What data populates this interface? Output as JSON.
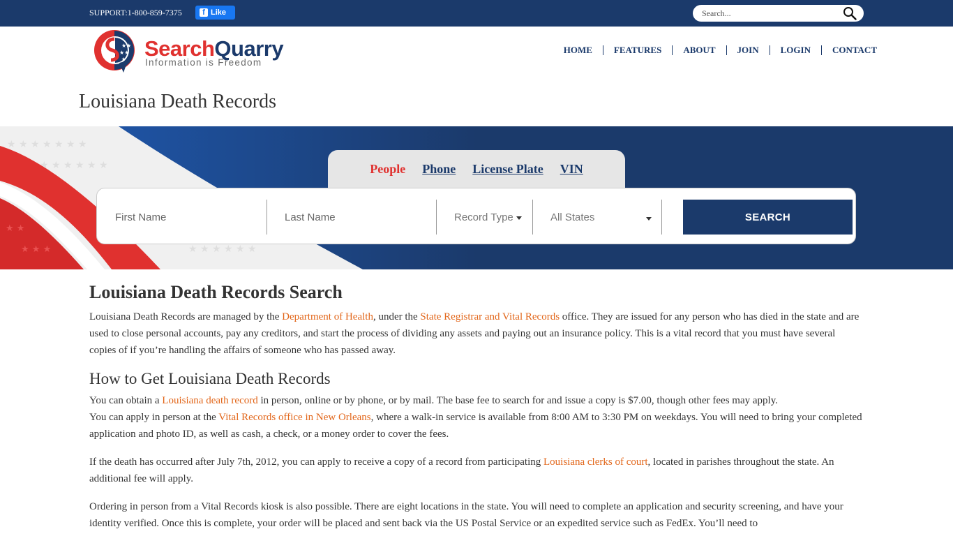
{
  "topbar": {
    "support_text": "SUPPORT:1-800-859-7375",
    "fb_like_label": "Like",
    "search_placeholder": "Search..."
  },
  "header": {
    "logo_name_part1": "Search",
    "logo_name_part2": "Quarry",
    "logo_tagline": "Information is Freedom",
    "nav": [
      "HOME",
      "FEATURES",
      "ABOUT",
      "JOIN",
      "LOGIN",
      "CONTACT"
    ]
  },
  "page_title": "Louisiana Death Records",
  "search": {
    "tabs": [
      {
        "label": "People",
        "active": true
      },
      {
        "label": "Phone",
        "active": false
      },
      {
        "label": "License Plate",
        "active": false
      },
      {
        "label": "VIN",
        "active": false
      }
    ],
    "first_name_placeholder": "First Name",
    "last_name_placeholder": "Last Name",
    "record_type_label": "Record Type",
    "state_label": "All States",
    "button_label": "SEARCH"
  },
  "article": {
    "h1": "Louisiana Death Records Search",
    "p1": {
      "t1": "Louisiana Death Records are managed by the ",
      "link1": "Department of Health",
      "t2": ", under the ",
      "link2": "State Registrar and Vital Records",
      "t3": " office. They are issued for any person who has died in the state and are used to close personal accounts, pay any creditors, and start the process of dividing any assets and paying out an insurance policy. This is a vital record that you must have several copies of if you’re handling the affairs of someone who has passed away."
    },
    "h2": "How to Get Louisiana Death Records",
    "p2": {
      "t1": "You can obtain a ",
      "link1": "Louisiana death record",
      "t2": " in person, online or by phone, or by mail. The base fee to search for and issue a copy is $7.00, though other fees may apply."
    },
    "p3": {
      "t1": "You can apply in person at the ",
      "link1": "Vital Records office in New Orleans",
      "t2": ", where a walk-in service is available from 8:00 AM to 3:30 PM on weekdays. You will need to bring your completed application and photo ID, as well as cash, a check, or a money order to cover the fees."
    },
    "p4": {
      "t1": "If the death has occurred after July 7th, 2012, you can apply to receive a copy of a record from participating ",
      "link1": "Louisiana clerks of court",
      "t2": ", located in parishes throughout the state. An additional fee will apply."
    },
    "p5": {
      "t1": "Ordering in person from a Vital Records kiosk is also possible. There are eight locations in the state. You will need to complete an application and security screening, and have your identity verified. Once this is complete, your order will be placed and sent back via the US Postal Service or an expedited service such as FedEx. You’ll need to"
    }
  },
  "colors": {
    "navy": "#1b3a6b",
    "red": "#e0312f",
    "link_orange": "#e2661a"
  }
}
